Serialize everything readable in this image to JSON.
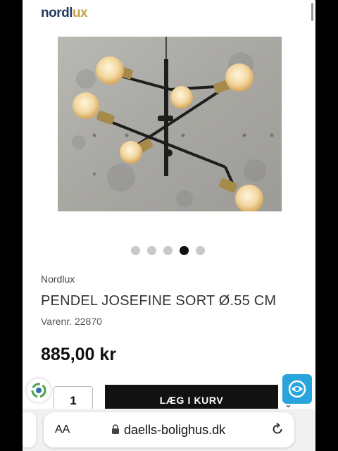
{
  "brand": {
    "name_main": "nordl",
    "name_accent": "ux"
  },
  "gallery": {
    "slide_count": 5,
    "active_index": 3
  },
  "product": {
    "manufacturer": "Nordlux",
    "title": "PENDEL JOSEFINE SORT Ø.55 CM",
    "sku": "Varenr. 22870",
    "price": "885,00 kr"
  },
  "cart": {
    "quantity": "1",
    "add_label": "LÆG I KURV"
  },
  "browser": {
    "text_size_label": "AA",
    "url": "daells-bolighus.dk"
  },
  "colors": {
    "button": "#111111",
    "badge_blue": "#29a5dd",
    "brand_blue": "#1f3a5f",
    "brand_gold": "#c8a24a"
  },
  "icons": [
    "recycle-icon",
    "eye-icon",
    "chevron-down-icon",
    "lock-icon",
    "reload-icon"
  ]
}
